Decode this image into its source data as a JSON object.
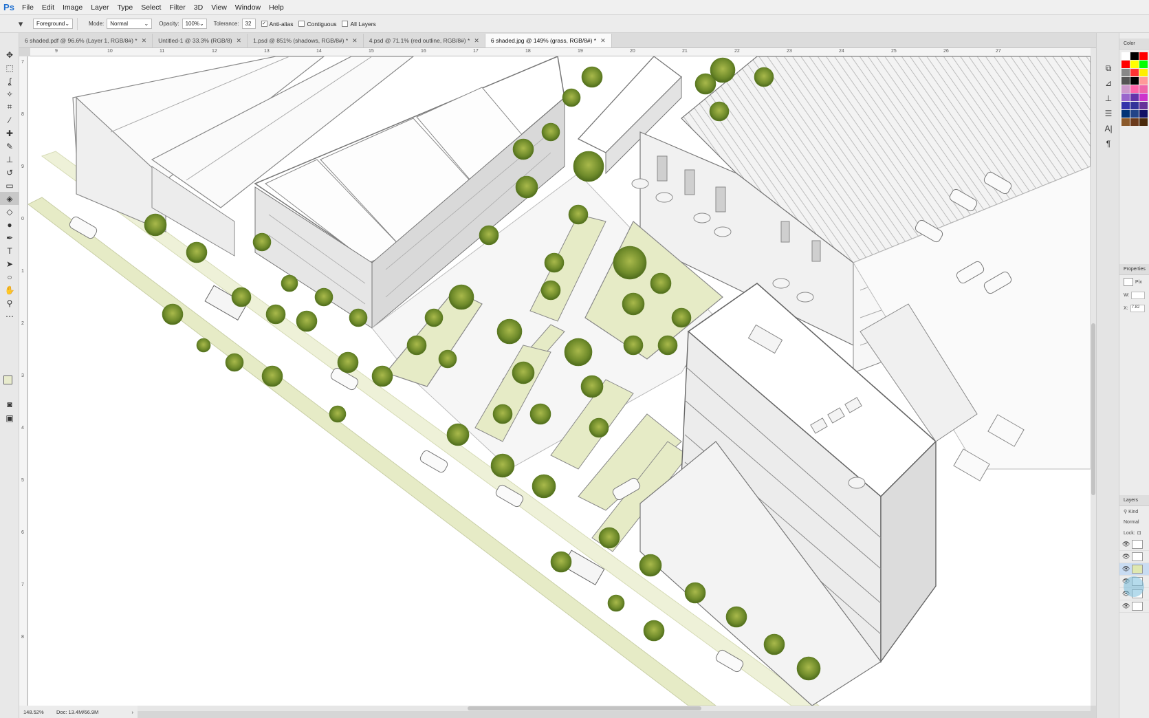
{
  "app": {
    "logo": "Ps"
  },
  "menu": [
    "File",
    "Edit",
    "Image",
    "Layer",
    "Type",
    "Select",
    "Filter",
    "3D",
    "View",
    "Window",
    "Help"
  ],
  "options": {
    "fill_source": "Foreground",
    "mode_label": "Mode:",
    "mode_value": "Normal",
    "opacity_label": "Opacity:",
    "opacity_value": "100%",
    "tolerance_label": "Tolerance:",
    "tolerance_value": "32",
    "antialias_label": "Anti-alias",
    "antialias_checked": true,
    "contiguous_label": "Contiguous",
    "contiguous_checked": false,
    "alllayers_label": "All Layers",
    "alllayers_checked": false
  },
  "tabs": [
    {
      "label": "6 shaded.pdf @ 96.6% (Layer 1, RGB/8#) *",
      "active": false
    },
    {
      "label": "Untitled-1 @ 33.3% (RGB/8)",
      "active": false
    },
    {
      "label": "1.psd @ 851% (shadows, RGB/8#) *",
      "active": false
    },
    {
      "label": "4.psd @ 71.1% (red outline, RGB/8#) *",
      "active": false
    },
    {
      "label": "6 shaded.jpg @ 149% (grass, RGB/8#) *",
      "active": true
    }
  ],
  "ruler": {
    "h": [
      "9",
      "10",
      "11",
      "12",
      "13",
      "14",
      "15",
      "16",
      "17",
      "18",
      "19",
      "20",
      "21",
      "22",
      "23",
      "24",
      "25",
      "26",
      "27"
    ],
    "v": [
      "7",
      "8",
      "9",
      "0",
      "1",
      "2",
      "3",
      "4",
      "5",
      "6",
      "7",
      "8"
    ]
  },
  "status": {
    "zoom": "148.52%",
    "doc": "Doc: 13.4M/66.9M"
  },
  "panels": {
    "color_title": "Color",
    "properties_title": "Properties",
    "properties_type": "Pix",
    "prop_w_label": "W:",
    "prop_x_label": "X:",
    "prop_x_value": "7.82",
    "layers_title": "Layers",
    "layers_filter": "Kind",
    "layers_blend": "Normal",
    "layers_lock": "Lock:"
  },
  "swatch_colors": [
    "#ffffff",
    "#000000",
    "#ff0000",
    "#ff0000",
    "#ffff00",
    "#00ff00",
    "#888888",
    "#ff3333",
    "#ffee00",
    "#555555",
    "#000000",
    "#ff9999",
    "#cc99cc",
    "#ff66aa",
    "#ee66aa",
    "#9966cc",
    "#6633aa",
    "#cc33cc",
    "#3333aa",
    "#333399",
    "#663399",
    "#003377",
    "#224488",
    "#111166",
    "#8b5a2b",
    "#6b3a1b",
    "#4a2a0b"
  ]
}
